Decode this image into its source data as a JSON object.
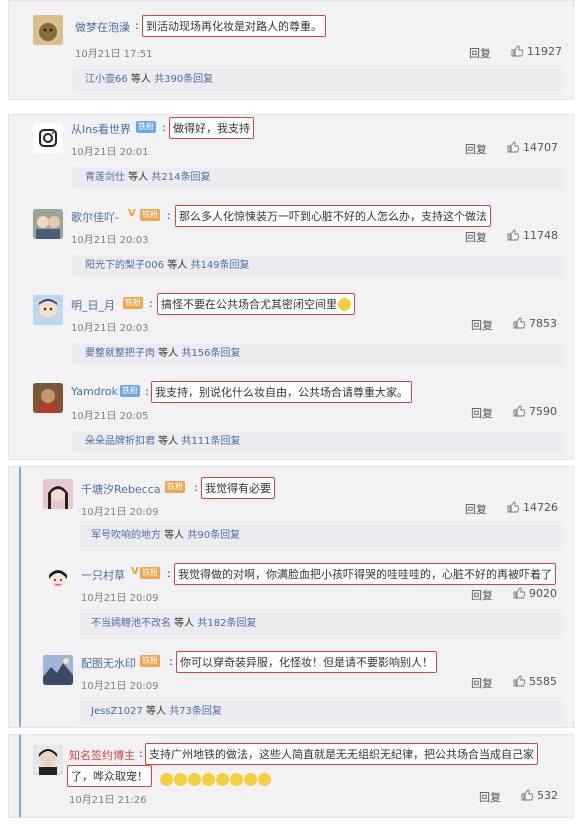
{
  "comments": [
    {
      "name": "做梦在泡澡",
      "text": "到活动现场再化妆是对路人的尊重。",
      "time": "10月21日 17:51",
      "reply": "回复",
      "likes": "11927",
      "sub_name": "江小壶66",
      "sub_mid": " 等人 ",
      "sub_count": "共390条回复"
    },
    {
      "name": "从Ins看世界",
      "badge": "铁粉",
      "text": "做得好，我支持",
      "time": "10月21日 20:01",
      "reply": "回复",
      "likes": "14707",
      "sub_name": "青莲剑仕",
      "sub_mid": " 等人 ",
      "sub_count": "共214条回复"
    },
    {
      "name": "歌尔佳吖-",
      "badge": "铁粉",
      "text": "那么多人化惊悚装万一吓到心脏不好的人怎么办，支持这个做法",
      "time": "10月21日 20:03",
      "reply": "回复",
      "likes": "11748",
      "sub_name": "阳光下的梨子006",
      "sub_mid": " 等人 ",
      "sub_count": "共149条回复"
    },
    {
      "name": "明_日_月",
      "badge": "铁粉",
      "text": "搞怪不要在公共场合尤其密闭空间里",
      "time": "10月21日 20:03",
      "reply": "回复",
      "likes": "7853",
      "sub_name": "要整就整把子肉",
      "sub_mid": " 等人 ",
      "sub_count": "共156条回复"
    },
    {
      "name": "Yamdrok",
      "badge": "铁粉",
      "text": "我支持，别说化什么妆自由，公共场合请尊重大家。",
      "time": "10月21日 20:05",
      "reply": "回复",
      "likes": "7590",
      "sub_name": "朵朵品牌折扣君",
      "sub_mid": " 等人 ",
      "sub_count": "共111条回复"
    },
    {
      "name": "千塘汐Rebecca",
      "badge": "铁粉",
      "text": "我觉得有必要",
      "time": "10月21日 20:09",
      "reply": "回复",
      "likes": "14726",
      "sub_name": "军号吹响的地方",
      "sub_mid": " 等人 ",
      "sub_count": "共90条回复"
    },
    {
      "name": "一只村草",
      "badge": "铁粉",
      "text": "我觉得做的对啊，你满脸血把小孩吓得哭的哇哇哇的，心脏不好的再被吓着了",
      "time": "10月21日 20:09",
      "reply": "回复",
      "likes": "9020",
      "sub_name": "不当嫣鲤池不改名",
      "sub_mid": " 等人 ",
      "sub_count": "共182条回复"
    },
    {
      "name": "配图无水印",
      "badge": "铁粉",
      "text": "你可以穿奇装异服，化怪妆！但是请不要影响别人！",
      "time": "10月21日 20:09",
      "reply": "回复",
      "likes": "5585",
      "sub_name": "JessZ1027",
      "sub_mid": " 等人 ",
      "sub_count": "共73条回复"
    },
    {
      "name": "知名签约博主",
      "text1": "支持广州地铁的做法，这些人简直就是无无组织无纪律，把公共场合当成自己家",
      "text2": "了，哗众取宠！",
      "time": "10月21日 21:26",
      "reply": "回复",
      "likes": "532"
    }
  ]
}
